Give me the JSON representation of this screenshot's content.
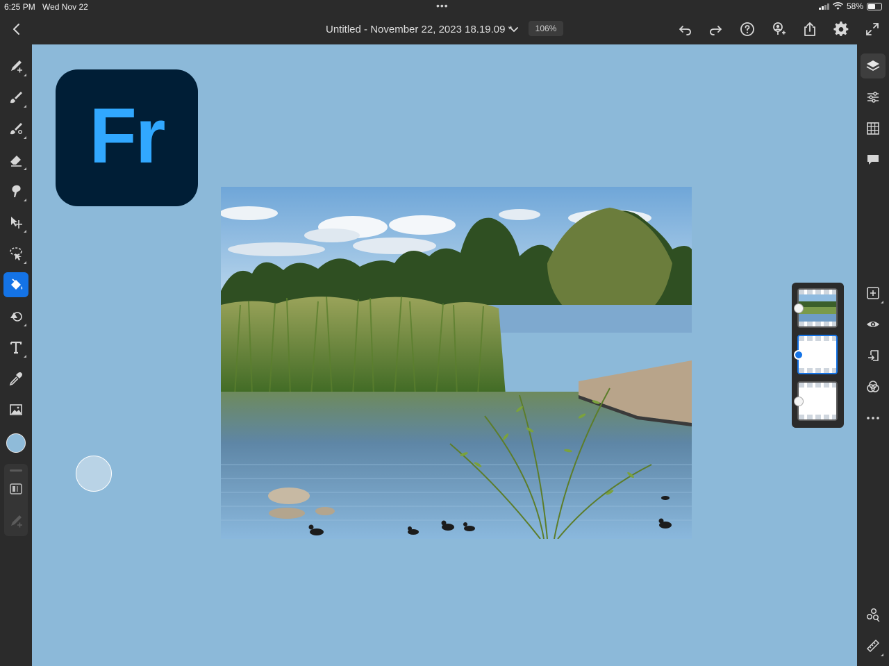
{
  "status_bar": {
    "time": "6:25 PM",
    "date": "Wed Nov 22",
    "more_dots": "•••",
    "battery": "58%",
    "battery_level": 0.58
  },
  "top_bar": {
    "back_icon": "chevron-left-icon",
    "document_title": "Untitled - November 22, 2023 18.19.09 *",
    "zoom_level": "106%",
    "actions": [
      "undo-icon",
      "redo-icon",
      "help-icon",
      "invite-user-icon",
      "share-icon",
      "settings-gear-icon",
      "fullscreen-icon"
    ]
  },
  "left_tools": {
    "items": [
      "pixel-brush-icon",
      "live-brush-icon",
      "vector-brush-icon",
      "eraser-icon",
      "smudge-icon",
      "transform-icon",
      "selection-lasso-icon",
      "fill-bucket-icon",
      "shapes-icon",
      "text-icon",
      "eyedropper-icon",
      "place-image-icon"
    ],
    "active": "fill-bucket-icon",
    "current_color": "#8fbbd9"
  },
  "canvas": {
    "background_color": "#8cb9d9",
    "logo_text": "Fr",
    "logo_colors": {
      "bg": "#001e36",
      "text": "#31a8ff"
    },
    "photo_subject": "lake-with-reeds-trees-and-coots-photo"
  },
  "layers_panel": {
    "layers": [
      {
        "name": "photo-layer",
        "type": "image",
        "active": false
      },
      {
        "name": "blank-layer",
        "type": "pixel",
        "active": true
      },
      {
        "name": "background-layer",
        "type": "pixel",
        "active": false
      }
    ]
  },
  "right_tools": {
    "top": [
      "layers-icon",
      "layer-properties-icon",
      "grid-icon",
      "comments-icon"
    ],
    "middle": [
      "add-layer-icon",
      "visibility-eye-icon",
      "import-layer-icon",
      "blend-mode-icon",
      "more-options-icon"
    ],
    "bottom": [
      "assets-icon",
      "ruler-icon"
    ],
    "active": "layers-icon"
  }
}
